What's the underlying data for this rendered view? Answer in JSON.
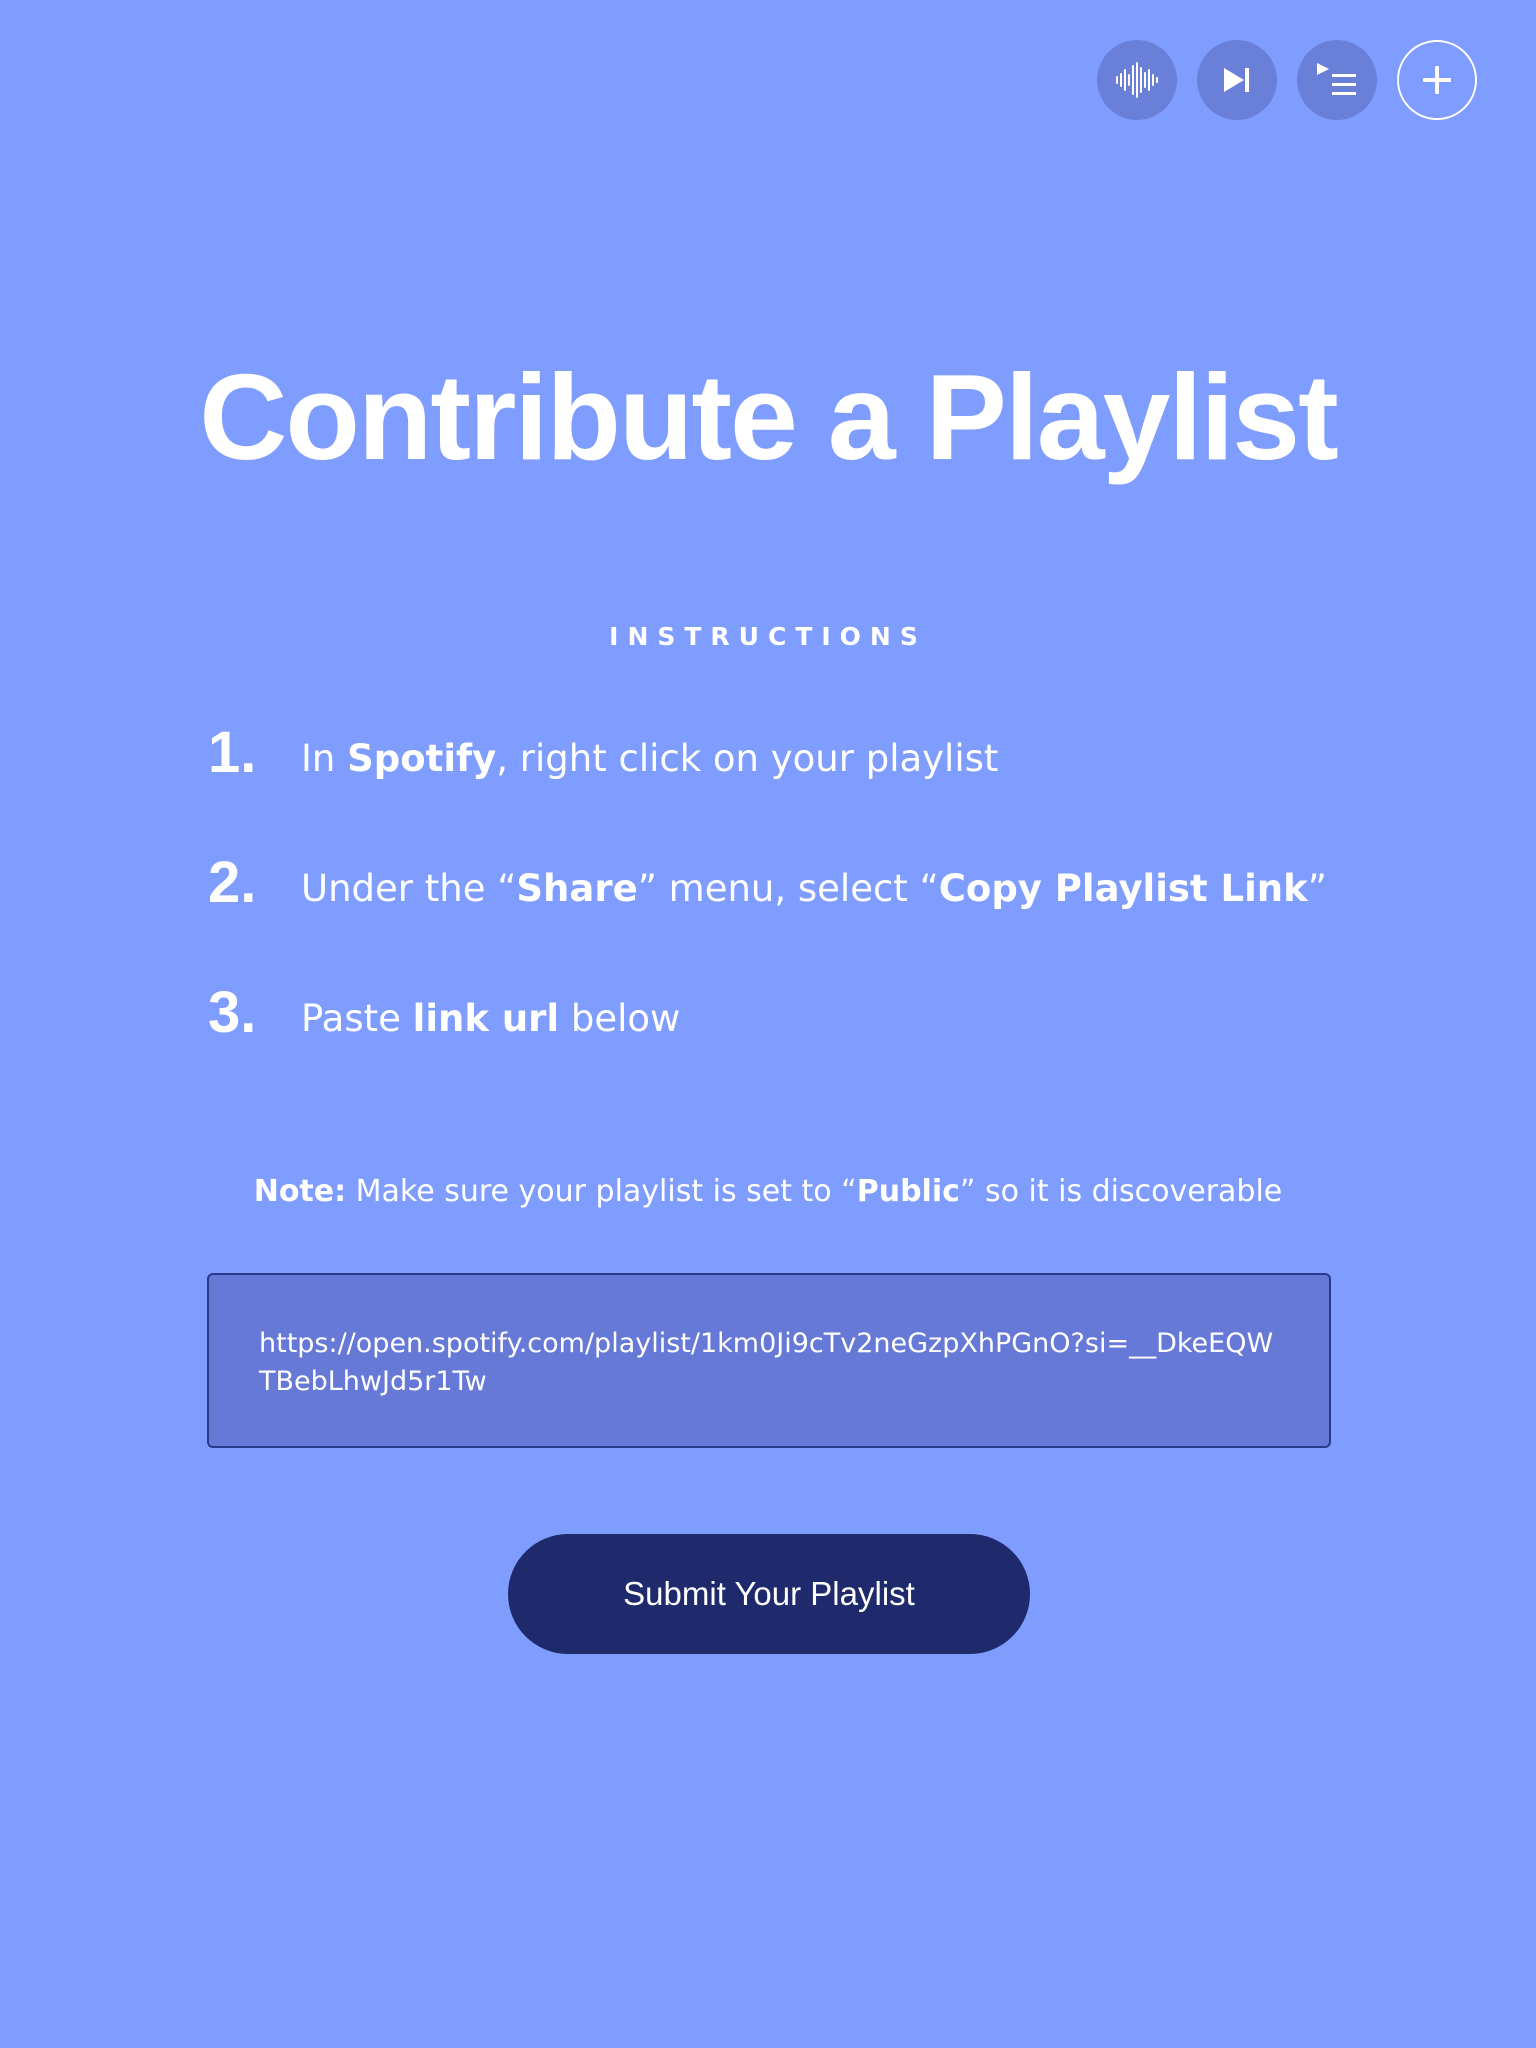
{
  "header": {
    "controls": [
      {
        "icon": "soundwave-icon",
        "label": "Visualizer"
      },
      {
        "icon": "skip-next-icon",
        "label": "Next"
      },
      {
        "icon": "queue-icon",
        "label": "Queue"
      },
      {
        "icon": "plus-icon",
        "label": "Add"
      }
    ]
  },
  "main": {
    "title": "Contribute a Playlist",
    "section_label": "INSTRUCTIONS",
    "steps": [
      {
        "num": "1.",
        "parts": [
          "In ",
          "Spotify",
          ", right click on your playlist"
        ]
      },
      {
        "num": "2.",
        "parts": [
          "Under the “",
          "Share",
          "” menu, select “",
          "Copy Playlist Link",
          "”"
        ]
      },
      {
        "num": "3.",
        "parts": [
          "Paste ",
          "link url",
          " below"
        ]
      }
    ],
    "note": {
      "bold": "Note:",
      "text1": " Make sure your playlist is set to “",
      "bold2": "Public",
      "text2": "” so it is discoverable"
    },
    "url_input": {
      "value": "https://open.spotify.com/playlist/1km0Ji9cTv2neGzpXhPGnO?si=__DkeEQWTBebLhwJd5r1Tw"
    },
    "submit_label": "Submit Your Playlist"
  },
  "colors": {
    "background": "#7f9cff",
    "control_bg": "#6a80d8",
    "input_bg": "#6779d6",
    "button_bg": "#1e2a6b"
  }
}
